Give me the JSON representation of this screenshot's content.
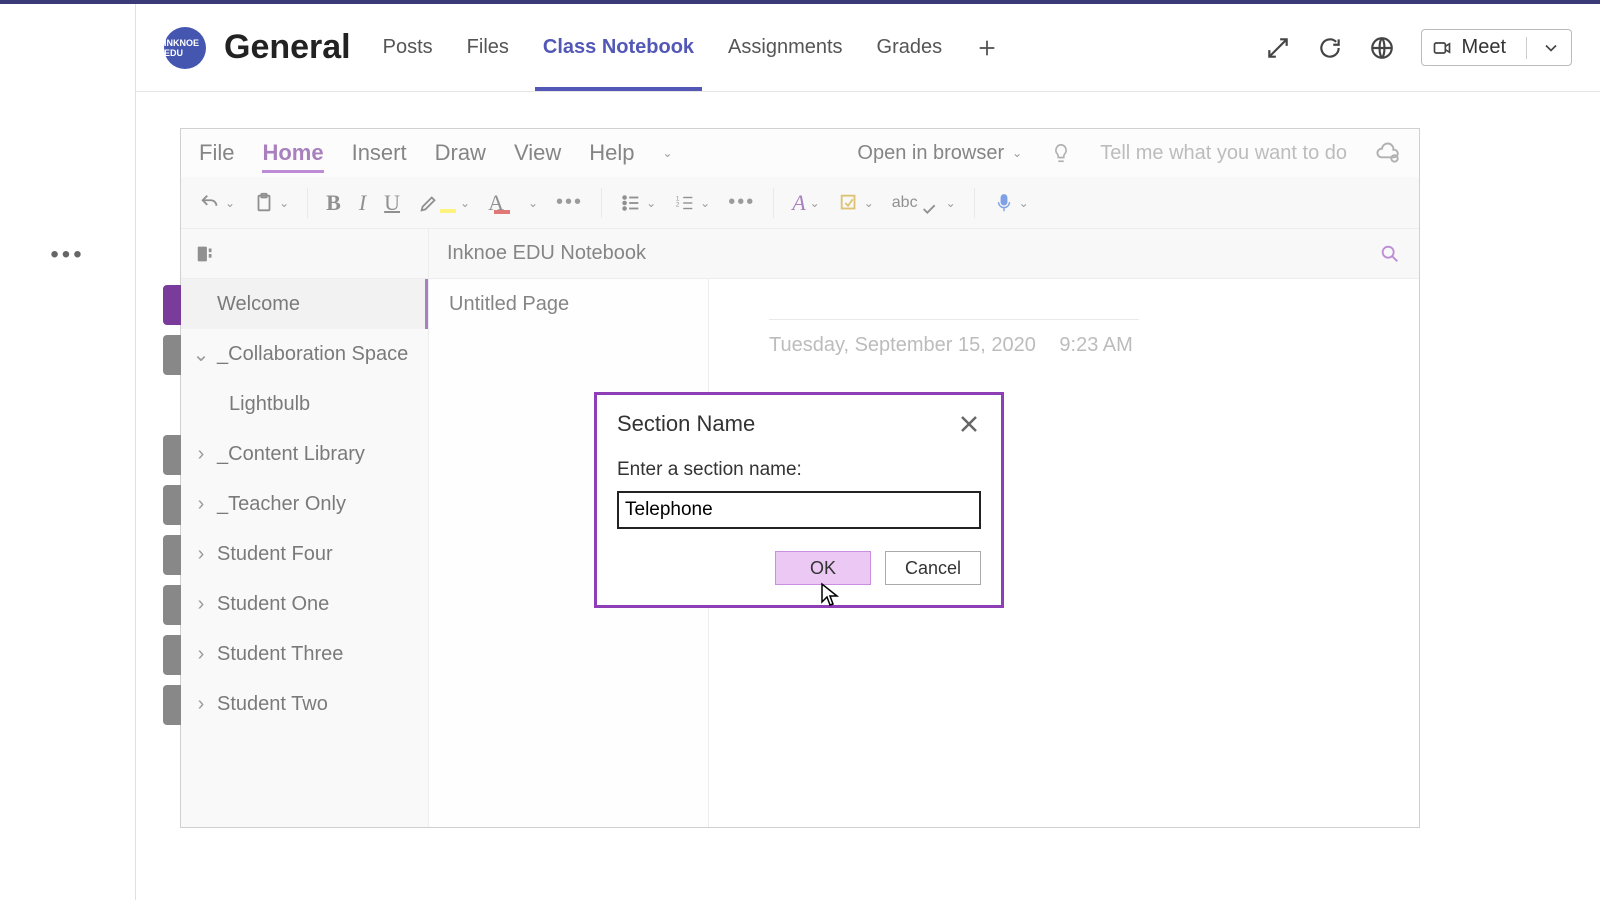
{
  "team": {
    "avatar_text": "INKNOE EDU"
  },
  "channel": {
    "title": "General"
  },
  "tabs": {
    "posts": "Posts",
    "files": "Files",
    "class_notebook": "Class Notebook",
    "assignments": "Assignments",
    "grades": "Grades"
  },
  "meet_label": "Meet",
  "ribbon": {
    "file": "File",
    "home": "Home",
    "insert": "Insert",
    "draw": "Draw",
    "view": "View",
    "help": "Help",
    "open_in_browser": "Open in browser",
    "tell_me": "Tell me what you want to do"
  },
  "notebook": {
    "title": "Inknoe EDU Notebook",
    "page_title": "Untitled Page",
    "date": "Tuesday, September 15, 2020",
    "time": "9:23 AM",
    "sections": {
      "welcome": "Welcome",
      "collab": "_Collaboration Space",
      "lightbulb": "Lightbulb",
      "content": "_Content Library",
      "teacher": "_Teacher Only",
      "s4": "Student Four",
      "s1": "Student One",
      "s3": "Student Three",
      "s2": "Student Two"
    }
  },
  "dialog": {
    "title": "Section Name",
    "label": "Enter a section name:",
    "value": "Telephone",
    "ok": "OK",
    "cancel": "Cancel"
  }
}
